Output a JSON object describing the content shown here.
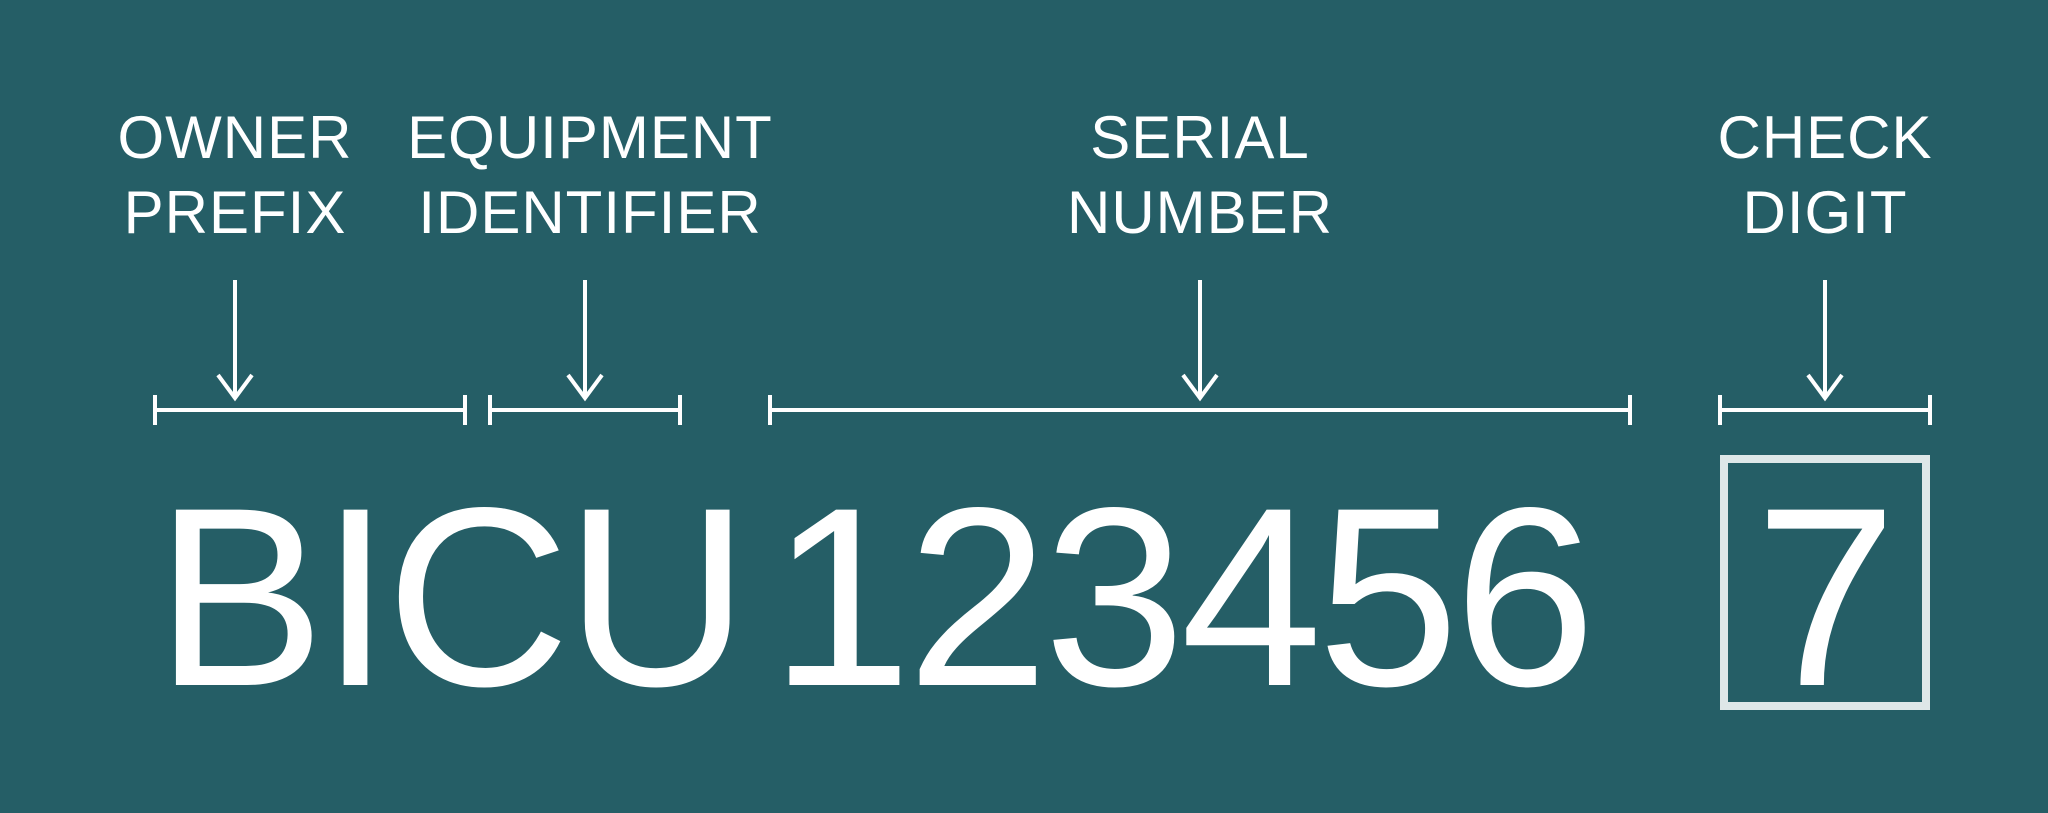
{
  "labels": {
    "owner_prefix_l1": "OWNER",
    "owner_prefix_l2": "PREFIX",
    "equipment_identifier_l1": "EQUIPMENT",
    "equipment_identifier_l2": "IDENTIFIER",
    "serial_number_l1": "SERIAL",
    "serial_number_l2": "NUMBER",
    "check_digit_l1": "CHECK",
    "check_digit_l2": "DIGIT"
  },
  "values": {
    "owner_prefix": "BIC",
    "equipment_identifier": "U",
    "serial_number": "123456",
    "check_digit": "7"
  }
}
